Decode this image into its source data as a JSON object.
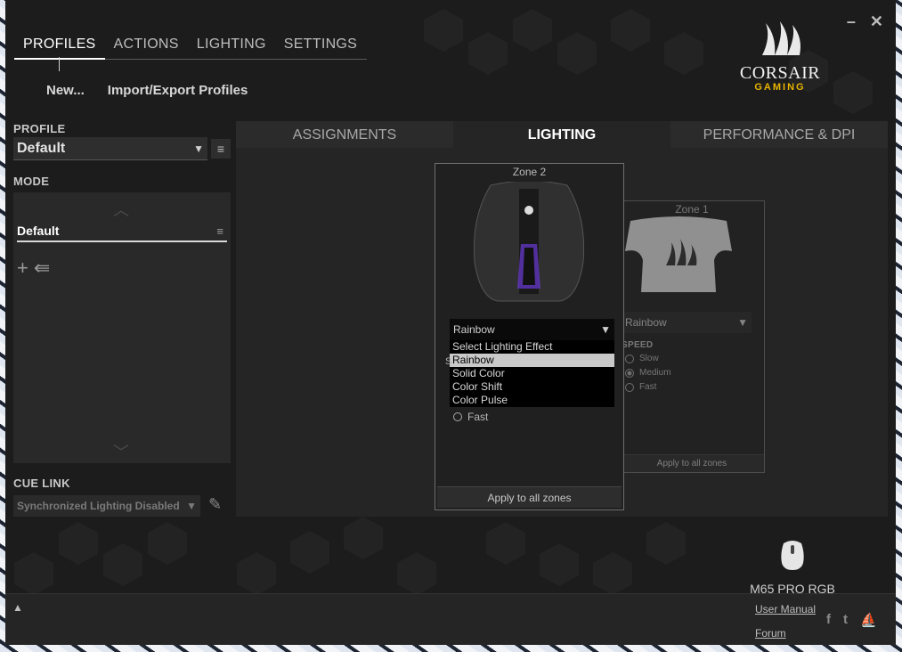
{
  "window": {
    "minimize": "–",
    "close": "✕"
  },
  "top_nav": {
    "items": [
      {
        "label": "PROFILES",
        "active": true
      },
      {
        "label": "ACTIONS",
        "active": false
      },
      {
        "label": "LIGHTING",
        "active": false
      },
      {
        "label": "SETTINGS",
        "active": false
      }
    ]
  },
  "sub_actions": {
    "new_label": "New...",
    "import_export_label": "Import/Export Profiles"
  },
  "logo": {
    "word": "CORSAIR",
    "sub": "GAMING"
  },
  "profile": {
    "label": "PROFILE",
    "value": "Default",
    "arrow": "▼",
    "menu": "≡"
  },
  "mode": {
    "label": "MODE",
    "selected": "Default",
    "burger": "≡",
    "up": "︿",
    "down": "﹀",
    "add": "+",
    "import": "⇚"
  },
  "cue_link": {
    "label": "CUE LINK",
    "value": "Synchronized Lighting Disabled",
    "arrow": "▼",
    "edit": "✎"
  },
  "tabs": [
    {
      "label": "ASSIGNMENTS",
      "active": false
    },
    {
      "label": "LIGHTING",
      "active": true
    },
    {
      "label": "PERFORMANCE & DPI",
      "active": false
    }
  ],
  "zone2": {
    "title": "Zone 2",
    "effect_value": "Rainbow",
    "arrow": "▼",
    "options": [
      "Select Lighting Effect",
      "Rainbow",
      "Solid Color",
      "Color Shift",
      "Color Pulse"
    ],
    "selected_option": "Rainbow",
    "speed_hidden_letter": "S",
    "fast_label": "Fast",
    "apply_label": "Apply to all zones"
  },
  "zone1": {
    "title": "Zone 1",
    "effect_value": "Rainbow",
    "arrow": "▼",
    "speed_label": "SPEED",
    "speed_options": [
      {
        "label": "Slow",
        "selected": false
      },
      {
        "label": "Medium",
        "selected": true
      },
      {
        "label": "Fast",
        "selected": false
      }
    ],
    "apply_label": "Apply to all zones"
  },
  "device": {
    "name": "M65 PRO RGB"
  },
  "footer": {
    "up": "▲",
    "user_manual": "User Manual",
    "forum": "Forum",
    "facebook": "f",
    "twitter": "t",
    "corsair": "⛵"
  },
  "colors": {
    "accent_yellow": "#e8b400",
    "zone_glow": "#6a3bd6"
  }
}
